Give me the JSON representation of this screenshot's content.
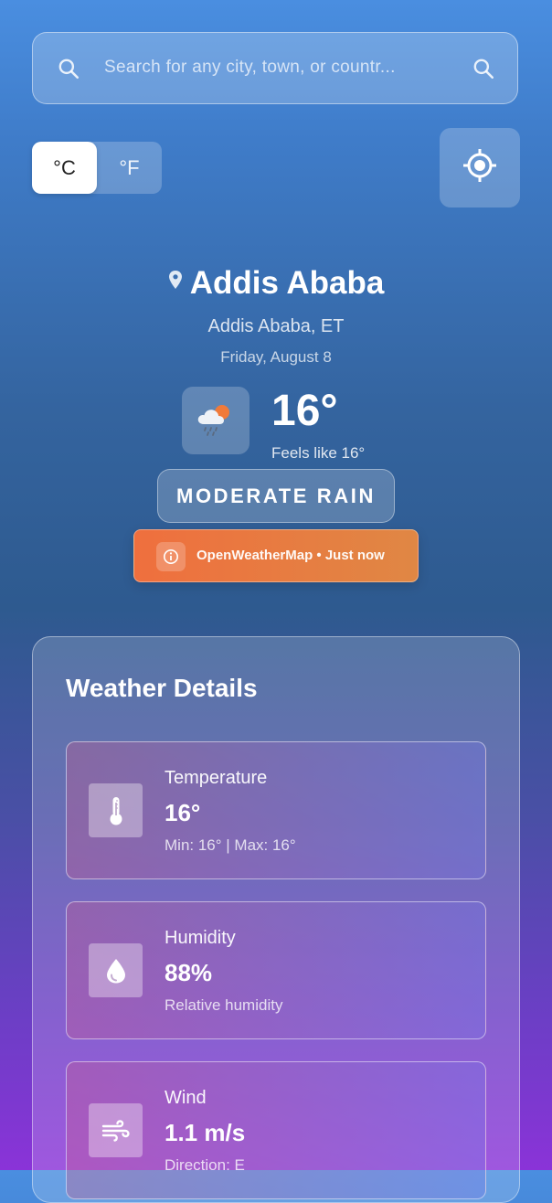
{
  "search": {
    "placeholder": "Search for any city, town, or countr..."
  },
  "units": {
    "celsius_label": "°C",
    "fahrenheit_label": "°F",
    "selected": "°C"
  },
  "location": {
    "city": "Addis Ababa",
    "region": "Addis Ababa, ET",
    "date": "Friday, August 8"
  },
  "current": {
    "temperature": "16°",
    "feels_like": "Feels like 16°",
    "condition": "MODERATE RAIN",
    "icon": "rain-cloud-sun-icon"
  },
  "source": {
    "text": "OpenWeatherMap • Just now"
  },
  "details": {
    "title": "Weather Details",
    "cards": [
      {
        "label": "Temperature",
        "value": "16°",
        "sub": "Min: 16° | Max: 16°",
        "icon": "thermometer-icon"
      },
      {
        "label": "Humidity",
        "value": "88%",
        "sub": "Relative humidity",
        "icon": "water-drop-icon"
      },
      {
        "label": "Wind",
        "value": "1.1 m/s",
        "sub": "Direction: E",
        "icon": "wind-icon"
      }
    ]
  },
  "colors": {
    "source_badge": "#ef6f3e",
    "background_top": "#4a8ee0",
    "background_bottom": "#8a33d8"
  }
}
